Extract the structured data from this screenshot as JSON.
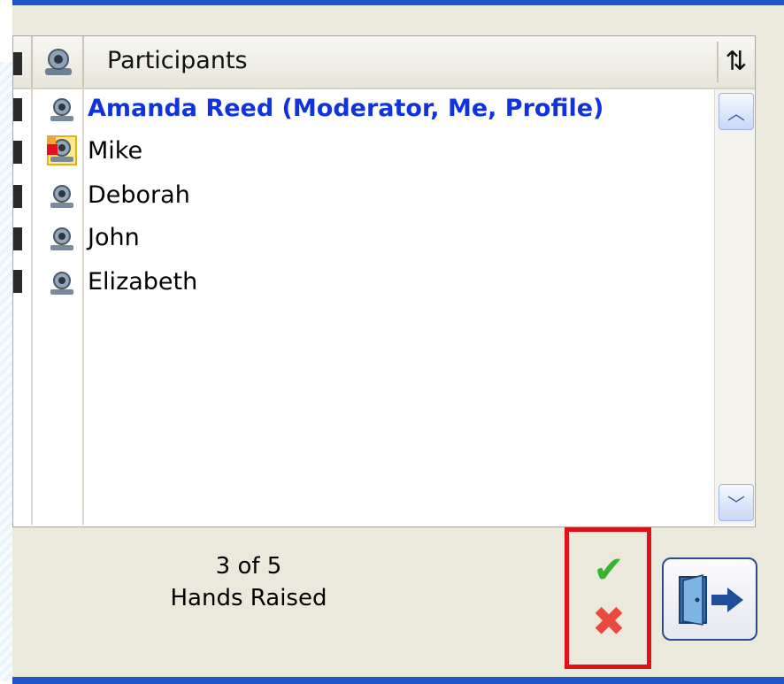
{
  "header": {
    "title": "Participants",
    "sort_icon": "sort-arrows-icon"
  },
  "participants": [
    {
      "name": "Amanda Reed (Moderator, Me, Profile)",
      "role": "moderator",
      "hand_raised": false
    },
    {
      "name": "Mike",
      "role": "participant",
      "hand_raised": true
    },
    {
      "name": "Deborah",
      "role": "participant",
      "hand_raised": false
    },
    {
      "name": "John",
      "role": "participant",
      "hand_raised": false
    },
    {
      "name": "Elizabeth",
      "role": "participant",
      "hand_raised": false
    }
  ],
  "footer": {
    "count_text": "3 of 5",
    "status_text": "Hands Raised"
  },
  "icons": {
    "scroll_up": "chevron-up-icon",
    "scroll_down": "chevron-down-icon",
    "approve": "check-icon",
    "deny": "x-icon",
    "exit": "exit-door-icon",
    "participant": "webcam-user-icon"
  },
  "colors": {
    "moderator_text": "#1133dd",
    "frame_border": "#1f56c7",
    "highlight_box": "#e10f18",
    "approve": "#3bb32f",
    "deny": "#e84a40"
  }
}
